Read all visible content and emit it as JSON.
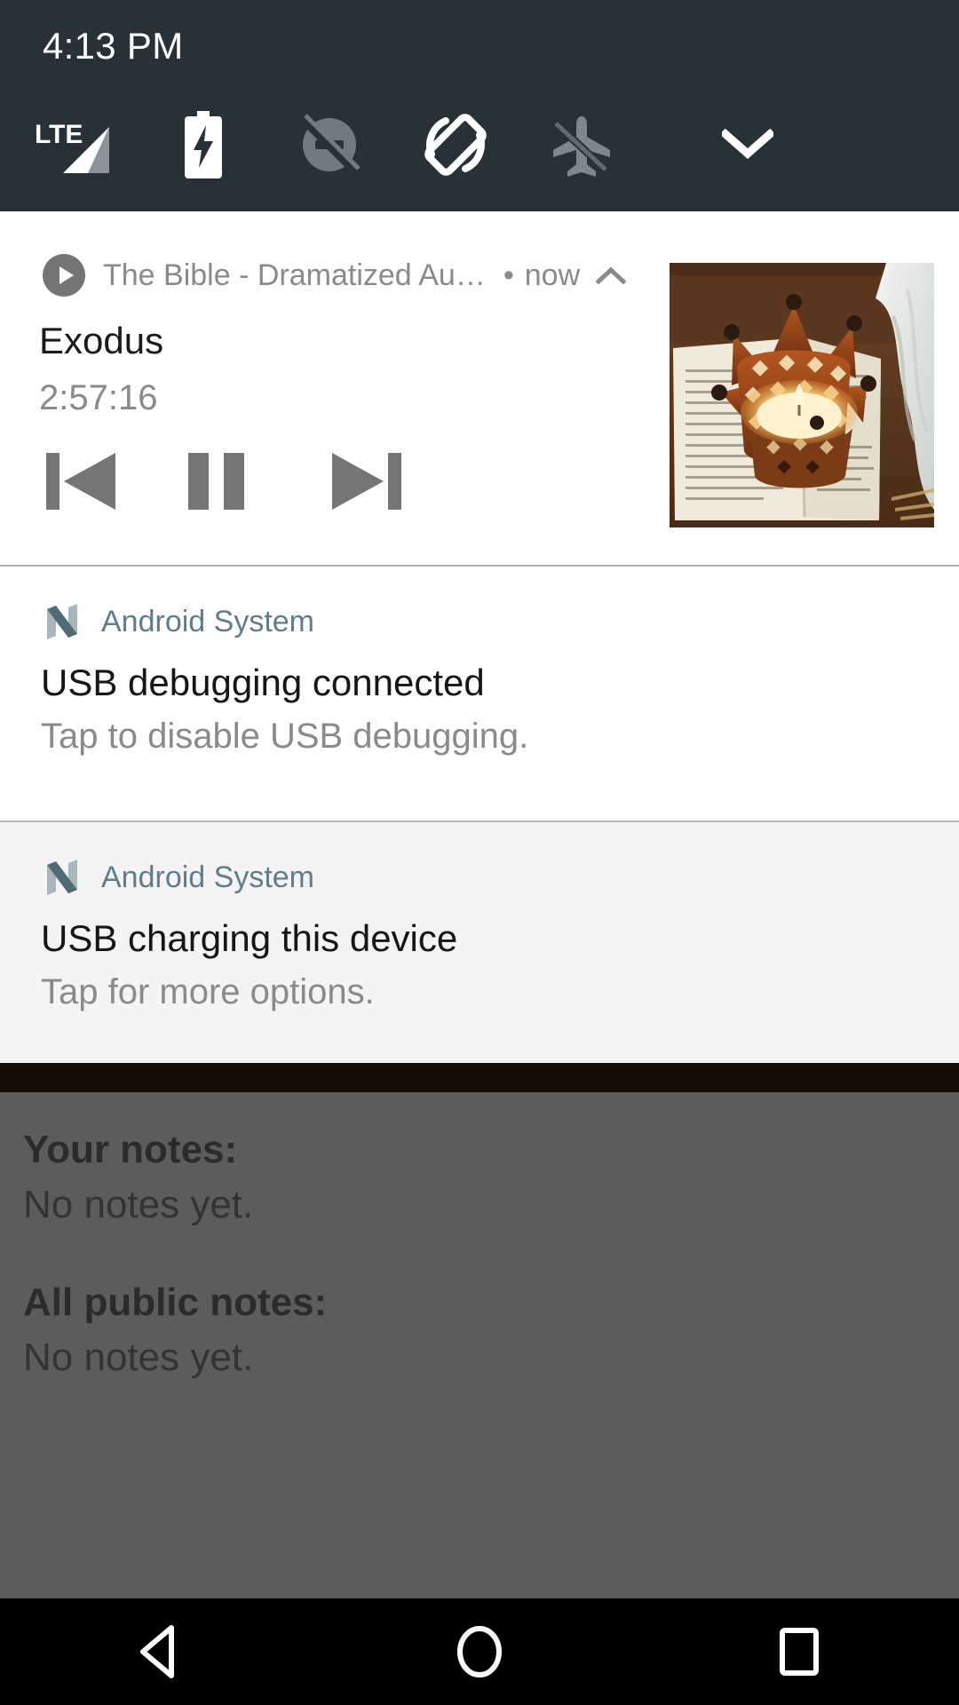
{
  "status_bar": {
    "clock": "4:13 PM",
    "icons": [
      {
        "name": "lte-signal-icon",
        "label": "LTE"
      },
      {
        "name": "battery-charging-icon",
        "label": "Battery charging"
      },
      {
        "name": "notifications-off-icon",
        "label": "Do not disturb"
      },
      {
        "name": "auto-rotate-icon",
        "label": "Auto-rotate"
      },
      {
        "name": "airplane-mode-off-icon",
        "label": "Airplane mode off"
      },
      {
        "name": "chevron-down-icon",
        "label": "Expand quick settings"
      }
    ],
    "background_color": "#263238"
  },
  "notifications": [
    {
      "type": "media",
      "app_name": "The Bible - Dramatized Au…",
      "separator": "•",
      "time": "now",
      "collapse_label": "Collapse",
      "title": "Exodus",
      "subtitle": "2:57:16",
      "controls": [
        {
          "name": "previous-track-button",
          "label": "Previous"
        },
        {
          "name": "pause-button",
          "label": "Pause"
        },
        {
          "name": "next-track-button",
          "label": "Next"
        }
      ],
      "album_art_alt": "Crown-shaped candle holder with lit candle on an open Bible",
      "background_color": "#ffffff"
    },
    {
      "type": "system",
      "app_name": "Android System",
      "title": "USB debugging connected",
      "text": "Tap to disable USB debugging.",
      "background_color": "#ffffff"
    },
    {
      "type": "system",
      "app_name": "Android System",
      "title": "USB charging this device",
      "text": "Tap for more options.",
      "background_color": "#f4f4f4"
    }
  ],
  "app_behind": {
    "sections": [
      {
        "heading": "Your notes:",
        "empty": "No notes yet."
      },
      {
        "heading": "All public notes:",
        "empty": "No notes yet."
      }
    ],
    "actionbar_color": "#170c03",
    "dim_color": "#5c5c5c"
  },
  "nav_bar": {
    "buttons": [
      {
        "name": "back-button",
        "label": "Back"
      },
      {
        "name": "home-button",
        "label": "Home"
      },
      {
        "name": "recents-button",
        "label": "Recent apps"
      }
    ],
    "background_color": "#000000"
  },
  "colors": {
    "status_bar_bg": "#263238",
    "accent_app_name": "#5f7d8c",
    "secondary_text": "#8a8a8a",
    "primary_text": "#161616"
  }
}
